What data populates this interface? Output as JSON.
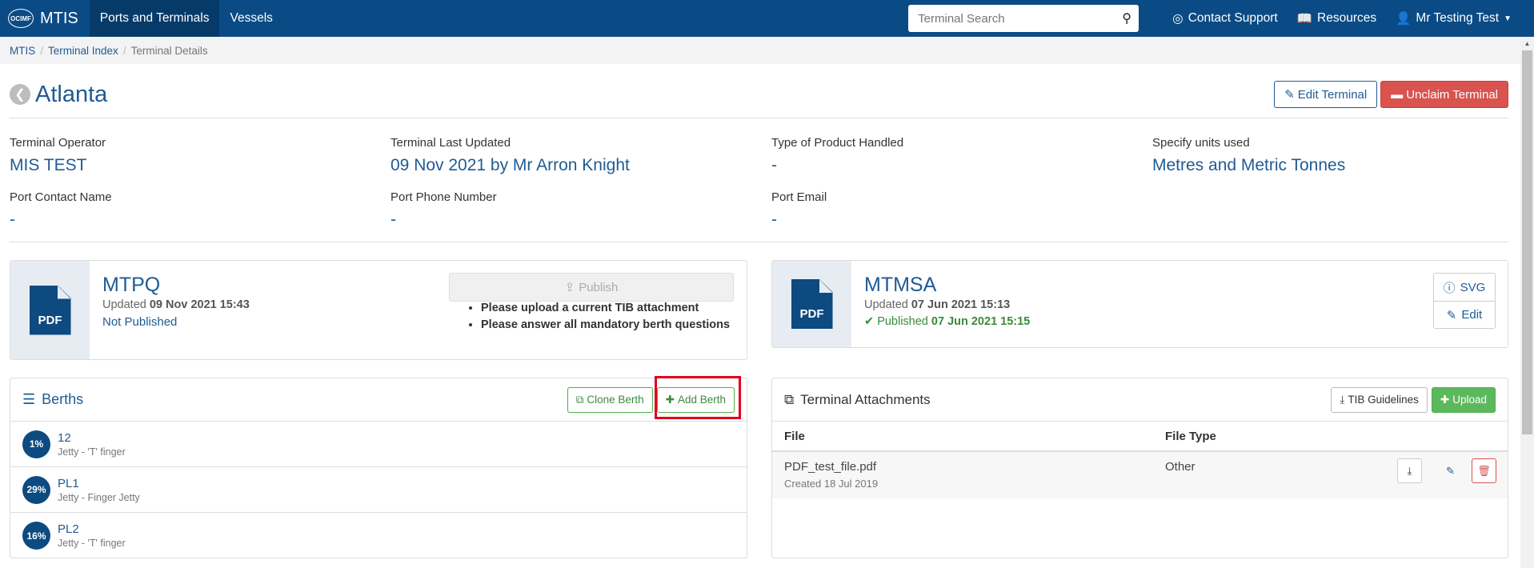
{
  "navbar": {
    "logo_text": "OCIMF",
    "brand": "MTIS",
    "nav_items": [
      "Ports and Terminals",
      "Vessels"
    ],
    "search_placeholder": "Terminal Search",
    "contact_support": "Contact Support",
    "resources": "Resources",
    "user": "Mr Testing Test"
  },
  "breadcrumb": [
    "MTIS",
    "Terminal Index",
    "Terminal Details"
  ],
  "page": {
    "title": "Atlanta",
    "edit_button": "Edit Terminal",
    "unclaim_button": "Unclaim Terminal"
  },
  "info": {
    "terminal_operator_label": "Terminal Operator",
    "terminal_operator": "MIS TEST",
    "last_updated_label": "Terminal Last Updated",
    "last_updated": "09 Nov 2021 by Mr Arron Knight",
    "product_label": "Type of Product Handled",
    "product": "-",
    "units_label": "Specify units used",
    "units": "Metres and Metric Tonnes",
    "contact_name_label": "Port Contact Name",
    "contact_name": "-",
    "phone_label": "Port Phone Number",
    "phone": "-",
    "email_label": "Port Email",
    "email": "-"
  },
  "mtpq": {
    "pdf_label": "PDF",
    "title": "MTPQ",
    "updated_prefix": "Updated",
    "updated": "09 Nov 2021 15:43",
    "status": "Not Published",
    "publish_button": "Publish",
    "requirements": [
      "Please upload a current TIB attachment",
      "Please answer all mandatory berth questions"
    ]
  },
  "mtmsa": {
    "pdf_label": "PDF",
    "title": "MTMSA",
    "updated_prefix": "Updated",
    "updated": "07 Jun 2021 15:13",
    "status_prefix": "Published",
    "status_date": "07 Jun 2021 15:15",
    "svg_button": "SVG",
    "edit_button": "Edit"
  },
  "berths": {
    "title": "Berths",
    "clone_button": "Clone Berth",
    "add_button": "Add Berth",
    "items": [
      {
        "pct": "1%",
        "name": "12",
        "type": "Jetty - 'T' finger"
      },
      {
        "pct": "29%",
        "name": "PL1",
        "type": "Jetty - Finger Jetty"
      },
      {
        "pct": "16%",
        "name": "PL2",
        "type": "Jetty - 'T' finger"
      }
    ]
  },
  "attachments": {
    "title": "Terminal Attachments",
    "guidelines_button": "TIB Guidelines",
    "upload_button": "Upload",
    "col_file": "File",
    "col_type": "File Type",
    "rows": [
      {
        "file": "PDF_test_file.pdf",
        "created": "Created 18 Jul 2019",
        "type": "Other"
      }
    ]
  },
  "colors": {
    "navbar": "#0a4b85",
    "primary": "#1f5b94",
    "danger": "#d9534f",
    "success": "#5cb85c",
    "highlight": "#e0001a"
  }
}
